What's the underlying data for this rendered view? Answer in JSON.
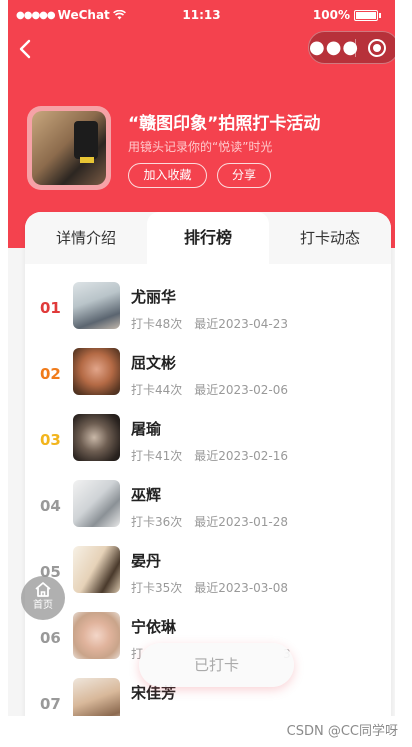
{
  "status_bar": {
    "carrier": "WeChat",
    "time": "11:13",
    "battery": "100%"
  },
  "nav": {
    "back_icon": "chevron-left-icon",
    "more_icon": "more-dots-icon",
    "close_icon": "target-close-icon"
  },
  "activity": {
    "title": "“赣图印象”拍照打卡活动",
    "subtitle": "用镜头记录你的“悦读”时光",
    "favorite_label": "加入收藏",
    "share_label": "分享"
  },
  "tabs": [
    {
      "label": "详情介绍",
      "active": false
    },
    {
      "label": "排行榜",
      "active": true
    },
    {
      "label": "打卡动态",
      "active": false
    }
  ],
  "ranking": [
    {
      "rank": "01",
      "name": "尤丽华",
      "count": "打卡48次",
      "recent": "最近2023-04-23",
      "rank_color": "#e03a3a"
    },
    {
      "rank": "02",
      "name": "屈文彬",
      "count": "打卡44次",
      "recent": "最近2023-02-06",
      "rank_color": "#f07b1b"
    },
    {
      "rank": "03",
      "name": "屠瑜",
      "count": "打卡41次",
      "recent": "最近2023-02-16",
      "rank_color": "#f2b51e"
    },
    {
      "rank": "04",
      "name": "巫辉",
      "count": "打卡36次",
      "recent": "最近2023-01-28",
      "rank_color": "#999999"
    },
    {
      "rank": "05",
      "name": "晏丹",
      "count": "打卡35次",
      "recent": "最近2023-03-08",
      "rank_color": "#999999"
    },
    {
      "rank": "06",
      "name": "宁依琳",
      "count": "打",
      "recent": "3",
      "rank_color": "#999999"
    },
    {
      "rank": "07",
      "name": "宋佳芳",
      "count": "",
      "recent": "",
      "rank_color": "#999999"
    }
  ],
  "home_fab": {
    "label": "首页",
    "icon": "home-icon"
  },
  "checkin_button": {
    "label": "已打卡"
  },
  "watermark": "CSDN @CC同学呀",
  "colors": {
    "brand": "#f4424e",
    "rank1": "#e03a3a",
    "rank2": "#f07b1b",
    "rank3": "#f2b51e"
  }
}
